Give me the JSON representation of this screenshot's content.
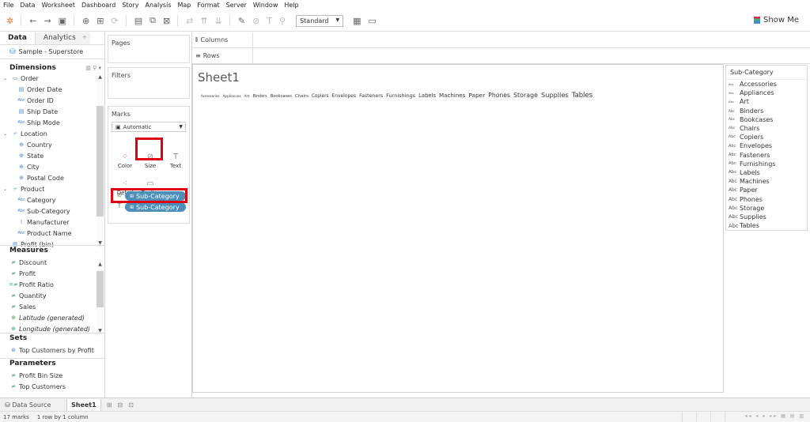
{
  "menu": [
    "File",
    "Data",
    "Worksheet",
    "Dashboard",
    "Story",
    "Analysis",
    "Map",
    "Format",
    "Server",
    "Window",
    "Help"
  ],
  "toolbar": {
    "fit": "Standard",
    "show_me": "Show Me"
  },
  "data_pane": {
    "tab_data": "Data",
    "tab_analytics": "Analytics",
    "datasource": "Sample - Superstore",
    "dimensions_label": "Dimensions",
    "dimensions": [
      {
        "label": "Order",
        "type": "folder",
        "level": 0
      },
      {
        "label": "Order Date",
        "type": "date",
        "level": 1
      },
      {
        "label": "Order ID",
        "type": "abc",
        "level": 1
      },
      {
        "label": "Ship Date",
        "type": "date",
        "level": 1
      },
      {
        "label": "Ship Mode",
        "type": "abc",
        "level": 1
      },
      {
        "label": "Location",
        "type": "hier",
        "level": 0
      },
      {
        "label": "Country",
        "type": "geo",
        "level": 1
      },
      {
        "label": "State",
        "type": "geo",
        "level": 1
      },
      {
        "label": "City",
        "type": "geo",
        "level": 1
      },
      {
        "label": "Postal Code",
        "type": "geo",
        "level": 1
      },
      {
        "label": "Product",
        "type": "hier",
        "level": 0
      },
      {
        "label": "Category",
        "type": "abc",
        "level": 1
      },
      {
        "label": "Sub-Category",
        "type": "abc",
        "level": 1
      },
      {
        "label": "Manufacturer",
        "type": "link",
        "level": 1
      },
      {
        "label": "Product Name",
        "type": "abc",
        "level": 1
      },
      {
        "label": "Profit (bin)",
        "type": "bin",
        "level": 0
      }
    ],
    "measures_label": "Measures",
    "measures": [
      {
        "label": "Discount",
        "type": "num",
        "italic": false
      },
      {
        "label": "Profit",
        "type": "num",
        "italic": false
      },
      {
        "label": "Profit Ratio",
        "type": "calc",
        "italic": false
      },
      {
        "label": "Quantity",
        "type": "num",
        "italic": false
      },
      {
        "label": "Sales",
        "type": "num",
        "italic": false
      },
      {
        "label": "Latitude (generated)",
        "type": "geo",
        "italic": true
      },
      {
        "label": "Longitude (generated)",
        "type": "geo",
        "italic": true
      }
    ],
    "sets_label": "Sets",
    "sets": [
      "Top Customers by Profit"
    ],
    "parameters_label": "Parameters",
    "parameters": [
      "Profit Bin Size",
      "Top Customers"
    ]
  },
  "cards": {
    "pages": "Pages",
    "filters": "Filters",
    "marks": "Marks",
    "mark_type": "Automatic",
    "buttons": [
      {
        "label": "Color",
        "icon": "color-icon",
        "glyph": "⁘"
      },
      {
        "label": "Size",
        "icon": "size-icon",
        "glyph": "⊘"
      },
      {
        "label": "Text",
        "icon": "text-icon",
        "glyph": "T"
      },
      {
        "label": "Detail",
        "icon": "detail-icon",
        "glyph": "⁖"
      },
      {
        "label": "Tooltip",
        "icon": "tooltip-icon",
        "glyph": "▭"
      }
    ],
    "pills": [
      {
        "label": "Sub-Category",
        "shelf_icon": "size-icon"
      },
      {
        "label": "Sub-Category",
        "shelf_icon": "text-icon"
      }
    ]
  },
  "shelves": {
    "columns": "Columns",
    "rows": "Rows"
  },
  "view": {
    "sheet_title": "Sheet1"
  },
  "chart_data": {
    "type": "table",
    "title": "Sheet1",
    "encoding": "text marks sized by Sub-Category",
    "marks": [
      {
        "label": "Accessories",
        "size_rank": 1
      },
      {
        "label": "Appliances",
        "size_rank": 2
      },
      {
        "label": "Art",
        "size_rank": 3
      },
      {
        "label": "Binders",
        "size_rank": 4
      },
      {
        "label": "Bookcases",
        "size_rank": 5
      },
      {
        "label": "Chairs",
        "size_rank": 6
      },
      {
        "label": "Copiers",
        "size_rank": 7
      },
      {
        "label": "Envelopes",
        "size_rank": 8
      },
      {
        "label": "Fasteners",
        "size_rank": 9
      },
      {
        "label": "Furnishings",
        "size_rank": 10
      },
      {
        "label": "Labels",
        "size_rank": 11
      },
      {
        "label": "Machines",
        "size_rank": 12
      },
      {
        "label": "Paper",
        "size_rank": 13
      },
      {
        "label": "Phones",
        "size_rank": 14
      },
      {
        "label": "Storage",
        "size_rank": 15
      },
      {
        "label": "Supplies",
        "size_rank": 16
      },
      {
        "label": "Tables",
        "size_rank": 17
      }
    ]
  },
  "legend": {
    "title": "Sub-Category",
    "items": [
      "Accessories",
      "Appliances",
      "Art",
      "Binders",
      "Bookcases",
      "Chairs",
      "Copiers",
      "Envelopes",
      "Fasteners",
      "Furnishings",
      "Labels",
      "Machines",
      "Paper",
      "Phones",
      "Storage",
      "Supplies",
      "Tables"
    ]
  },
  "sheet_tabs": {
    "datasource": "Data Source",
    "active": "Sheet1"
  },
  "status": {
    "marks": "17 marks",
    "dims": "1 row by 1 column"
  },
  "colors": {
    "pill": "#4c8fb8",
    "highlight": "#e00010"
  }
}
